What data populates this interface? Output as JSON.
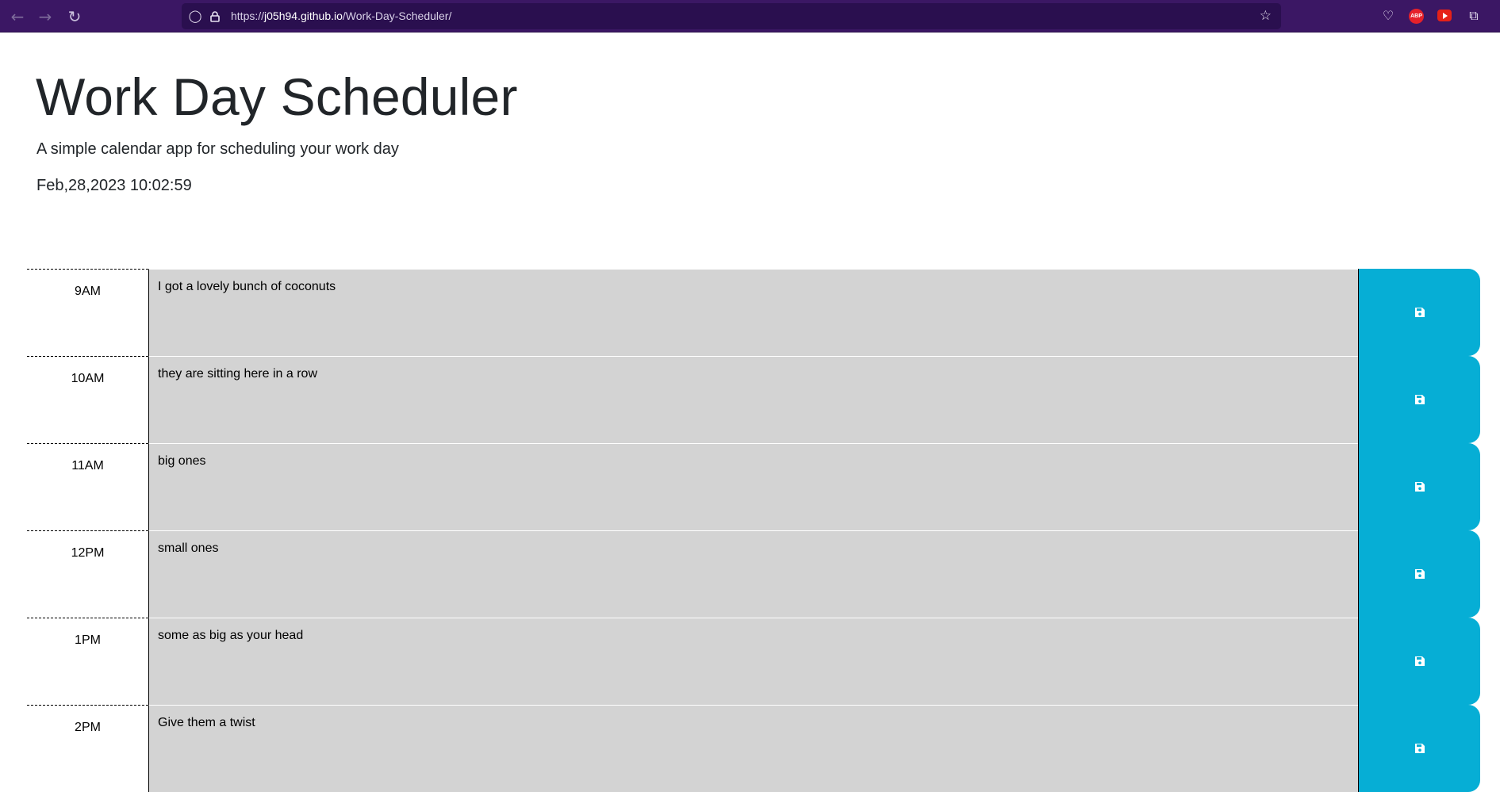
{
  "browser": {
    "url_prefix": "https://",
    "url_host": "j05h94.github.io",
    "url_path": "/Work-Day-Scheduler/",
    "icons": {
      "back": "back-arrow-icon",
      "forward": "forward-arrow-icon",
      "reload": "reload-icon",
      "shield": "shield-icon",
      "lock": "lock-icon",
      "bookmark": "star-icon",
      "pocket": "pocket-icon",
      "adblock": "adblock-plus-icon",
      "adblock_text": "ABP",
      "youtube": "youtube-icon",
      "extensions": "extensions-puzzle-icon"
    },
    "colors": {
      "toolbar": "#3b1764",
      "urlbar": "#2a0f4f"
    }
  },
  "header": {
    "title": "Work Day Scheduler",
    "subtitle": "A simple calendar app for scheduling your work day",
    "current_day": "Feb,28,2023 10:02:59"
  },
  "time_blocks": [
    {
      "hour": "9AM",
      "text": "I got a lovely bunch of coconuts"
    },
    {
      "hour": "10AM",
      "text": "they are sitting here in a row"
    },
    {
      "hour": "11AM",
      "text": "big ones"
    },
    {
      "hour": "12PM",
      "text": "small ones"
    },
    {
      "hour": "1PM",
      "text": "some as big as your head"
    },
    {
      "hour": "2PM",
      "text": "Give them a twist"
    }
  ],
  "save_icon": "save-floppy-icon",
  "colors": {
    "description_bg": "#d3d3d3",
    "save_button": "#06aed5"
  }
}
